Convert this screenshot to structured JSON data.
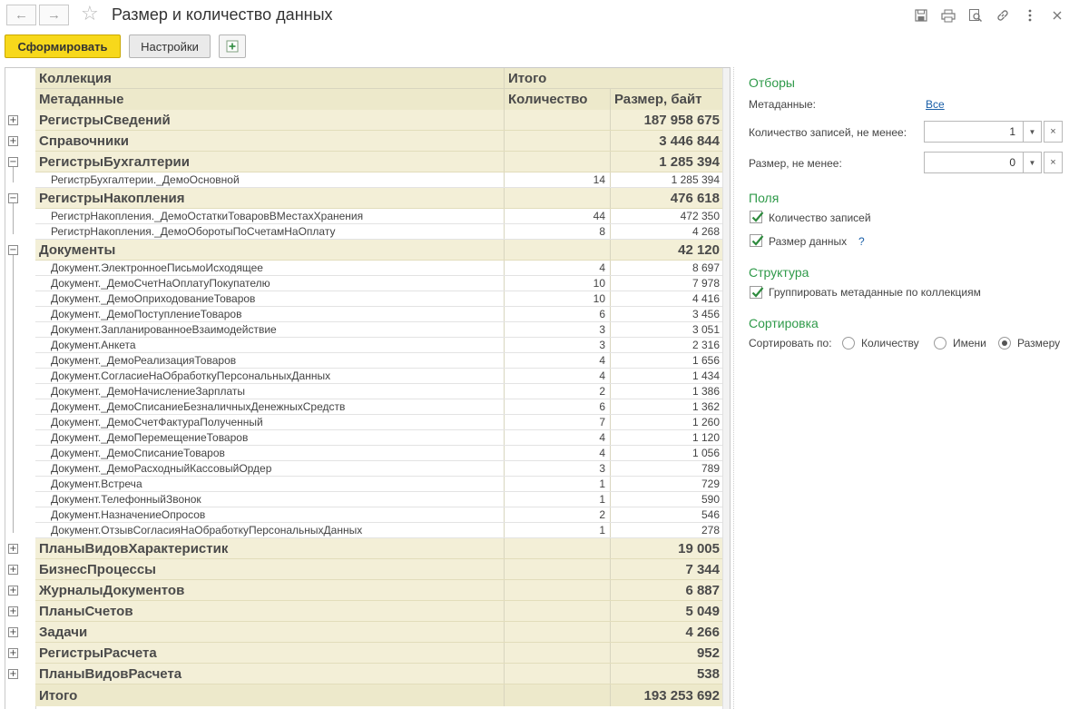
{
  "window": {
    "title": "Размер и количество данных",
    "back_icon": "←",
    "forward_icon": "→",
    "star_icon": "☆"
  },
  "toolbar": {
    "generate_label": "Сформировать",
    "settings_label": "Настройки"
  },
  "table": {
    "header": {
      "collection": "Коллекция",
      "total": "Итого",
      "metadata": "Метаданные",
      "count": "Количество",
      "size": "Размер, байт"
    },
    "groups": [
      {
        "name": "РегистрыСведений",
        "size": "187 958 675",
        "expanded": false,
        "items": []
      },
      {
        "name": "Справочники",
        "size": "3 446 844",
        "expanded": false,
        "items": []
      },
      {
        "name": "РегистрыБухгалтерии",
        "size": "1 285 394",
        "expanded": true,
        "items": [
          {
            "name": "РегистрБухгалтерии._ДемоОсновной",
            "count": "14",
            "size": "1 285 394"
          }
        ]
      },
      {
        "name": "РегистрыНакопления",
        "size": "476 618",
        "expanded": true,
        "items": [
          {
            "name": "РегистрНакопления._ДемоОстаткиТоваровВМестахХранения",
            "count": "44",
            "size": "472 350"
          },
          {
            "name": "РегистрНакопления._ДемоОборотыПоСчетамНаОплату",
            "count": "8",
            "size": "4 268"
          }
        ]
      },
      {
        "name": "Документы",
        "size": "42 120",
        "expanded": true,
        "items": [
          {
            "name": "Документ.ЭлектронноеПисьмоИсходящее",
            "count": "4",
            "size": "8 697"
          },
          {
            "name": "Документ._ДемоСчетНаОплатуПокупателю",
            "count": "10",
            "size": "7 978"
          },
          {
            "name": "Документ._ДемоОприходованиеТоваров",
            "count": "10",
            "size": "4 416"
          },
          {
            "name": "Документ._ДемоПоступлениеТоваров",
            "count": "6",
            "size": "3 456"
          },
          {
            "name": "Документ.ЗапланированноеВзаимодействие",
            "count": "3",
            "size": "3 051"
          },
          {
            "name": "Документ.Анкета",
            "count": "3",
            "size": "2 316"
          },
          {
            "name": "Документ._ДемоРеализацияТоваров",
            "count": "4",
            "size": "1 656"
          },
          {
            "name": "Документ.СогласиеНаОбработкуПерсональныхДанных",
            "count": "4",
            "size": "1 434"
          },
          {
            "name": "Документ._ДемоНачислениеЗарплаты",
            "count": "2",
            "size": "1 386"
          },
          {
            "name": "Документ._ДемоСписаниеБезналичныхДенежныхСредств",
            "count": "6",
            "size": "1 362"
          },
          {
            "name": "Документ._ДемоСчетФактураПолученный",
            "count": "7",
            "size": "1 260"
          },
          {
            "name": "Документ._ДемоПеремещениеТоваров",
            "count": "4",
            "size": "1 120"
          },
          {
            "name": "Документ._ДемоСписаниеТоваров",
            "count": "4",
            "size": "1 056"
          },
          {
            "name": "Документ._ДемоРасходныйКассовыйОрдер",
            "count": "3",
            "size": "789"
          },
          {
            "name": "Документ.Встреча",
            "count": "1",
            "size": "729"
          },
          {
            "name": "Документ.ТелефонныйЗвонок",
            "count": "1",
            "size": "590"
          },
          {
            "name": "Документ.НазначениеОпросов",
            "count": "2",
            "size": "546"
          },
          {
            "name": "Документ.ОтзывСогласияНаОбработкуПерсональныхДанных",
            "count": "1",
            "size": "278"
          }
        ]
      },
      {
        "name": "ПланыВидовХарактеристик",
        "size": "19 005",
        "expanded": false,
        "items": []
      },
      {
        "name": "БизнесПроцессы",
        "size": "7 344",
        "expanded": false,
        "items": []
      },
      {
        "name": "ЖурналыДокументов",
        "size": "6 887",
        "expanded": false,
        "items": []
      },
      {
        "name": "ПланыСчетов",
        "size": "5 049",
        "expanded": false,
        "items": []
      },
      {
        "name": "Задачи",
        "size": "4 266",
        "expanded": false,
        "items": []
      },
      {
        "name": "РегистрыРасчета",
        "size": "952",
        "expanded": false,
        "items": []
      },
      {
        "name": "ПланыВидовРасчета",
        "size": "538",
        "expanded": false,
        "items": []
      }
    ],
    "total": {
      "label": "Итого",
      "size": "193 253 692"
    }
  },
  "panel": {
    "filters_title": "Отборы",
    "metadata_label": "Метаданные:",
    "metadata_value": "Все",
    "min_records_label": "Количество записей, не менее:",
    "min_records_value": "1",
    "min_size_label": "Размер, не менее:",
    "min_size_value": "0",
    "fields_title": "Поля",
    "field_count_label": "Количество записей",
    "field_count_checked": true,
    "field_size_label": "Размер данных",
    "field_size_checked": true,
    "field_size_help": "?",
    "structure_title": "Структура",
    "group_label": "Группировать метаданные по коллекциям",
    "group_checked": true,
    "sort_title": "Сортировка",
    "sort_by_label": "Сортировать по:",
    "sort_options": [
      "Количеству",
      "Имени",
      "Размеру"
    ],
    "sort_selected": "Размеру"
  }
}
